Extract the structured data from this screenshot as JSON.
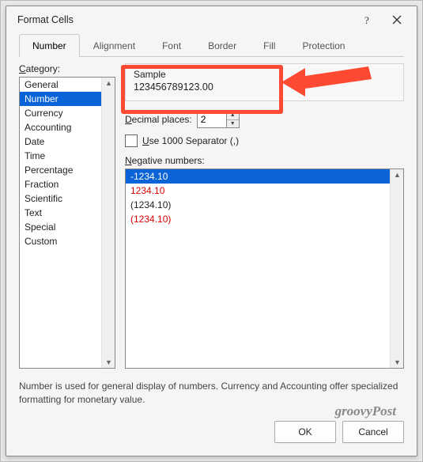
{
  "dialog": {
    "title": "Format Cells"
  },
  "tabs": [
    "Number",
    "Alignment",
    "Font",
    "Border",
    "Fill",
    "Protection"
  ],
  "activeTab": 0,
  "categoryLabel": "Category:",
  "categories": [
    "General",
    "Number",
    "Currency",
    "Accounting",
    "Date",
    "Time",
    "Percentage",
    "Fraction",
    "Scientific",
    "Text",
    "Special",
    "Custom"
  ],
  "categorySelectedIndex": 1,
  "sample": {
    "label": "Sample",
    "value": "123456789123.00"
  },
  "decimal": {
    "label": "Decimal places:",
    "value": "2"
  },
  "separator": {
    "label": "Use 1000 Separator (,)",
    "checked": false
  },
  "negative": {
    "label": "Negative numbers:",
    "items": [
      {
        "text": "-1234.10",
        "color": "#ffffff",
        "selected": true
      },
      {
        "text": "1234.10",
        "color": "#d80000"
      },
      {
        "text": "(1234.10)",
        "color": "#000000"
      },
      {
        "text": "(1234.10)",
        "color": "#d80000"
      }
    ]
  },
  "description": "Number is used for general display of numbers.  Currency and Accounting offer specialized formatting for monetary value.",
  "buttons": {
    "ok": "OK",
    "cancel": "Cancel"
  },
  "watermark": "groovyPost"
}
